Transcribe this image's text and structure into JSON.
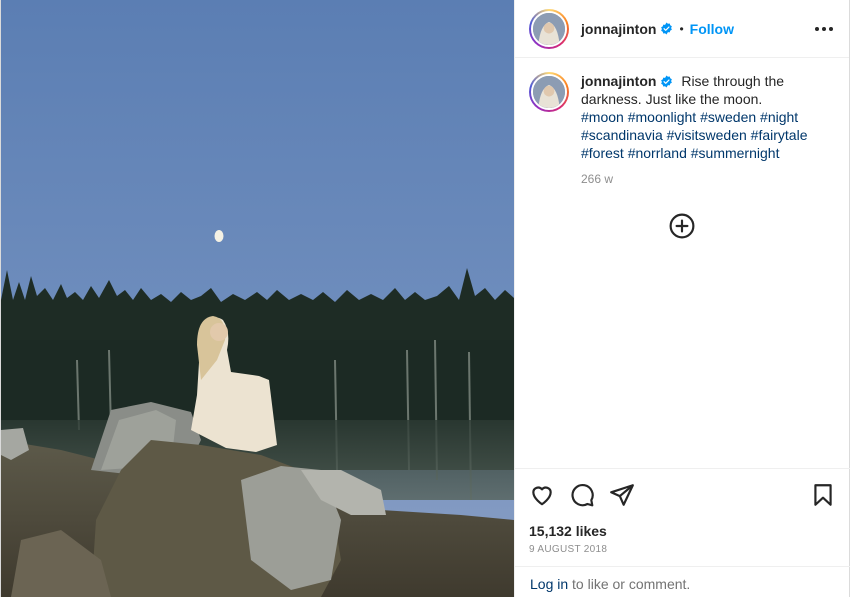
{
  "post": {
    "username": "jonnajinton",
    "follow_label": "Follow",
    "dot": "•",
    "caption_text": "Rise through the darkness. Just like the moon.",
    "hashtags": [
      "#moon",
      "#moonlight",
      "#sweden",
      "#night",
      "#scandinavia",
      "#visitsweden",
      "#fairytale",
      "#forest",
      "#norrland",
      "#summernight"
    ],
    "time_ago": "266 w",
    "likes": "15,132 likes",
    "date": "9 AUGUST 2018"
  },
  "footer": {
    "login_link": "Log in",
    "login_rest": " to like or comment."
  },
  "icons": {
    "verified": "verified-badge-icon",
    "more": "more-options-icon",
    "add_comment": "add-comment-icon",
    "like": "heart-icon",
    "comment": "comment-icon",
    "share": "share-icon",
    "save": "bookmark-icon"
  },
  "colors": {
    "accent": "#0095f6",
    "hashtag": "#00376b",
    "muted": "#8e8e8e",
    "text": "#262626"
  }
}
